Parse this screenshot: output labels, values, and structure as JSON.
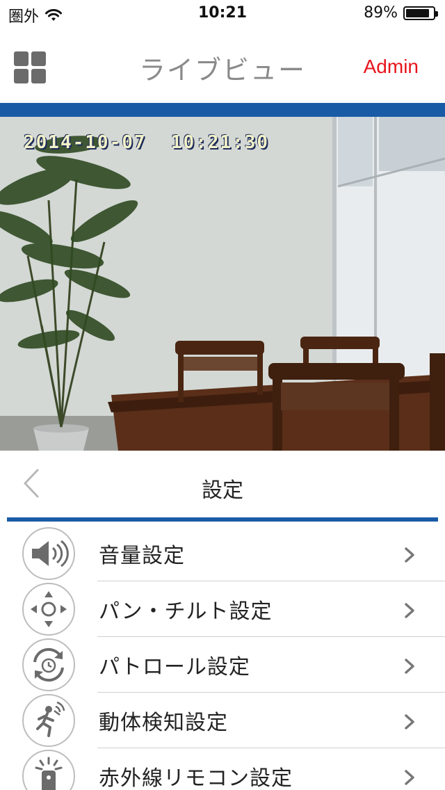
{
  "status_bar": {
    "carrier": "圏外",
    "time": "10:21",
    "battery_percent": "89%",
    "battery_level": 0.89
  },
  "nav": {
    "title": "ライブビュー",
    "user": "Admin",
    "accent_color": "#e8141b",
    "brand_color": "#1a5ba6"
  },
  "camera": {
    "timestamp": "2014-10-07  10:21:30"
  },
  "settings": {
    "title": "設定",
    "items": [
      {
        "label": "音量設定",
        "icon": "speaker-icon"
      },
      {
        "label": "パン・チルト設定",
        "icon": "pan-tilt-icon"
      },
      {
        "label": "パトロール設定",
        "icon": "patrol-icon"
      },
      {
        "label": "動体検知設定",
        "icon": "motion-detect-icon"
      },
      {
        "label": "赤外線リモコン設定",
        "icon": "ir-remote-icon"
      }
    ]
  }
}
